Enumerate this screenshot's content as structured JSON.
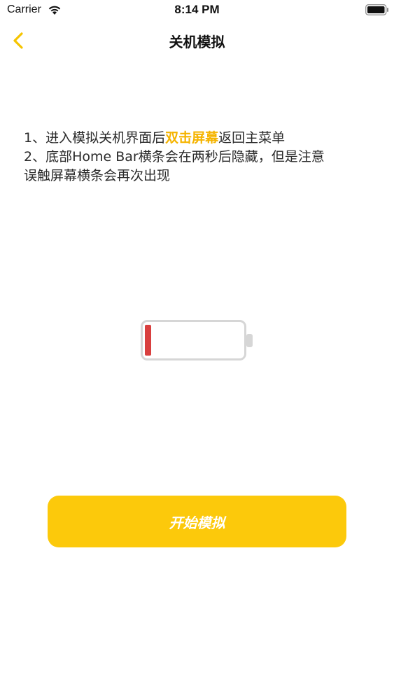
{
  "status_bar": {
    "carrier": "Carrier",
    "time": "8:14 PM",
    "wifi_icon": "wifi-icon",
    "battery_icon": "battery-full-icon"
  },
  "nav": {
    "back_icon": "chevron-left-icon",
    "title": "关机模拟",
    "accent_color": "#f5c400"
  },
  "instructions": {
    "line1_prefix": "1、进入模拟关机界面后",
    "line1_highlight": "双击屏幕",
    "line1_suffix": "返回主菜单",
    "line2": "2、底部Home Bar横条会在两秒后隐藏，但是注意",
    "line3": "误触屏幕横条会再次出现",
    "highlight_color": "#f5b400"
  },
  "battery_illustration": {
    "icon": "low-battery-icon",
    "level_percent": 5,
    "level_color": "#d9403f"
  },
  "start_button": {
    "label": "开始模拟",
    "color": "#fcc90b"
  }
}
